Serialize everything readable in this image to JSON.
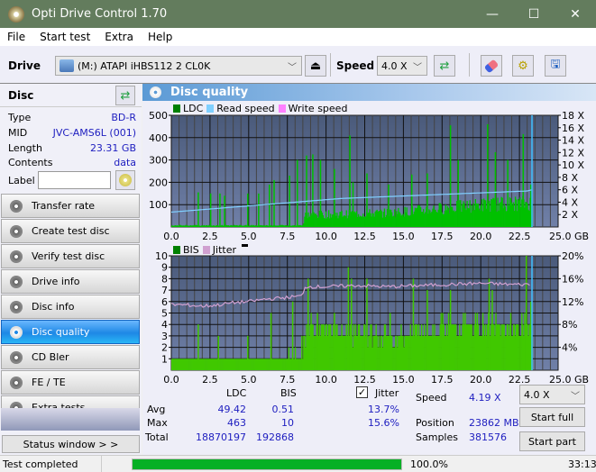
{
  "window": {
    "title": "Opti Drive Control 1.70",
    "minimize": "—",
    "maximize": "☐",
    "close": "✕"
  },
  "menu": [
    "File",
    "Start test",
    "Extra",
    "Help"
  ],
  "toolbar": {
    "drive_label": "Drive",
    "drive_value": "(M:)  ATAPI iHBS112  2 CL0K",
    "speed_label": "Speed",
    "speed_value": "4.0 X"
  },
  "disc": {
    "header": "Disc",
    "rows": [
      {
        "label": "Type",
        "value": "BD-R"
      },
      {
        "label": "MID",
        "value": "JVC-AMS6L (001)"
      },
      {
        "label": "Length",
        "value": "23.31 GB"
      },
      {
        "label": "Contents",
        "value": "data"
      }
    ],
    "label_field": "Label",
    "label_value": ""
  },
  "nav": [
    {
      "label": "Transfer rate",
      "active": false
    },
    {
      "label": "Create test disc",
      "active": false
    },
    {
      "label": "Verify test disc",
      "active": false
    },
    {
      "label": "Drive info",
      "active": false
    },
    {
      "label": "Disc info",
      "active": false
    },
    {
      "label": "Disc quality",
      "active": true
    },
    {
      "label": "CD Bler",
      "active": false
    },
    {
      "label": "FE / TE",
      "active": false
    },
    {
      "label": "Extra tests",
      "active": false
    }
  ],
  "status_window_btn": "Status window > >",
  "panel_title": "Disc quality",
  "colors": {
    "ldc": "#00c000",
    "read": "#80d0ff",
    "write": "#ff80ff",
    "bis": "#00c000",
    "jitter": "#d0a0d0",
    "plot_top": "#4a5a7a",
    "plot_bottom": "#7080a8",
    "progress": "#06b025"
  },
  "chart_data": [
    {
      "type": "bar",
      "title": "LDC",
      "legend": [
        "LDC",
        "Read speed",
        "Write speed"
      ],
      "xlabel": "GB",
      "x_ticks": [
        "0.0",
        "2.5",
        "5.0",
        "7.5",
        "10.0",
        "12.5",
        "15.0",
        "17.5",
        "20.0",
        "22.5",
        "25.0 GB"
      ],
      "xlim": [
        0,
        25
      ],
      "y_left_ticks": [
        "500",
        "400",
        "300",
        "200",
        "100"
      ],
      "ylim": [
        0,
        500
      ],
      "y_right_ticks": [
        "18 X",
        "16 X",
        "14 X",
        "12 X",
        "10 X",
        "8 X",
        "6 X",
        "4 X",
        "2 X"
      ],
      "y_right_lim": [
        0,
        18
      ],
      "ldc_baseline": [
        [
          0,
          8
        ],
        [
          8.5,
          8
        ],
        [
          8.6,
          60
        ],
        [
          14,
          70
        ],
        [
          17,
          90
        ],
        [
          20,
          110
        ],
        [
          23.3,
          120
        ]
      ],
      "ldc_peaks": [
        [
          1.7,
          155
        ],
        [
          2.5,
          150
        ],
        [
          3.1,
          150
        ],
        [
          3.4,
          140
        ],
        [
          4.9,
          150
        ],
        [
          5.6,
          150
        ],
        [
          6.3,
          190
        ],
        [
          6.6,
          210
        ],
        [
          7.6,
          230
        ],
        [
          8.1,
          300
        ],
        [
          8.7,
          320
        ],
        [
          9.1,
          325
        ],
        [
          9.6,
          300
        ],
        [
          10.5,
          260
        ],
        [
          11.5,
          410
        ],
        [
          11.7,
          200
        ],
        [
          12.6,
          240
        ],
        [
          14.0,
          190
        ],
        [
          15.5,
          235
        ],
        [
          16.5,
          240
        ],
        [
          18.0,
          455
        ],
        [
          18.5,
          300
        ],
        [
          20.4,
          460
        ],
        [
          20.9,
          335
        ],
        [
          21.7,
          300
        ],
        [
          22.7,
          416
        ],
        [
          23.2,
          190
        ]
      ],
      "read_speed": [
        [
          0,
          2.4
        ],
        [
          1,
          2.6
        ],
        [
          2,
          2.8
        ],
        [
          3,
          3.0
        ],
        [
          4,
          3.2
        ],
        [
          5,
          3.4
        ],
        [
          6,
          3.6
        ],
        [
          7,
          3.8
        ],
        [
          8,
          4.0
        ],
        [
          9,
          4.2
        ],
        [
          10,
          4.4
        ],
        [
          11,
          4.6
        ],
        [
          13,
          4.8
        ],
        [
          15,
          5.0
        ],
        [
          17,
          5.2
        ],
        [
          19,
          5.4
        ],
        [
          21,
          5.6
        ],
        [
          23,
          5.8
        ],
        [
          23.3,
          6.0
        ]
      ],
      "end_marker_gb": 23.31
    },
    {
      "type": "bar",
      "title": "BIS",
      "legend": [
        "BIS",
        "Jitter"
      ],
      "xlabel": "GB",
      "x_ticks": [
        "0.0",
        "2.5",
        "5.0",
        "7.5",
        "10.0",
        "12.5",
        "15.0",
        "17.5",
        "20.0",
        "22.5",
        "25.0 GB"
      ],
      "xlim": [
        0,
        25
      ],
      "y_left_ticks": [
        "10",
        "9",
        "8",
        "7",
        "6",
        "5",
        "4",
        "3",
        "2",
        "1"
      ],
      "ylim": [
        0,
        10
      ],
      "y_right_ticks": [
        "20%",
        "16%",
        "12%",
        "8%",
        "4%"
      ],
      "y_right_lim": [
        0,
        20
      ],
      "bis_baseline": [
        [
          0,
          1
        ],
        [
          7.5,
          1
        ],
        [
          7.6,
          2
        ],
        [
          8.6,
          3
        ],
        [
          9,
          4
        ],
        [
          14,
          3
        ],
        [
          17.5,
          4
        ],
        [
          23.3,
          4
        ]
      ],
      "bis_peaks": [
        [
          1.7,
          4
        ],
        [
          3.0,
          3
        ],
        [
          4.9,
          3
        ],
        [
          6.4,
          5
        ],
        [
          7.8,
          6
        ],
        [
          8.8,
          8
        ],
        [
          9.4,
          5
        ],
        [
          10.5,
          5
        ],
        [
          11.4,
          9
        ],
        [
          11.6,
          8
        ],
        [
          12.6,
          8
        ],
        [
          14.1,
          5
        ],
        [
          15.6,
          8
        ],
        [
          16.5,
          7
        ],
        [
          17.5,
          5
        ],
        [
          18.0,
          7
        ],
        [
          20.5,
          8
        ],
        [
          20.7,
          7
        ],
        [
          22.9,
          10
        ],
        [
          23.2,
          6
        ]
      ],
      "jitter": [
        [
          0,
          11.5
        ],
        [
          1,
          11.4
        ],
        [
          2,
          11.2
        ],
        [
          3,
          11.4
        ],
        [
          4,
          11.8
        ],
        [
          5,
          12.0
        ],
        [
          6,
          12.4
        ],
        [
          7,
          12.6
        ],
        [
          8.5,
          13.0
        ],
        [
          8.6,
          14.6
        ],
        [
          10,
          14.6
        ],
        [
          12,
          14.8
        ],
        [
          14,
          14.6
        ],
        [
          16,
          14.8
        ],
        [
          18,
          15.0
        ],
        [
          20,
          15.2
        ],
        [
          22,
          15.0
        ],
        [
          23.2,
          15.0
        ]
      ],
      "end_marker_gb": 23.31
    }
  ],
  "stats": {
    "col_ldc": "LDC",
    "col_bis": "BIS",
    "jitter_checked": true,
    "jitter_label": "Jitter",
    "avg_label": "Avg",
    "max_label": "Max",
    "total_label": "Total",
    "ldc_avg": "49.42",
    "ldc_max": "463",
    "ldc_total": "18870197",
    "bis_avg": "0.51",
    "bis_max": "10",
    "bis_total": "192868",
    "jitter_avg": "13.7%",
    "jitter_max": "15.6%",
    "speed_label": "Speed",
    "speed_value": "4.19 X",
    "position_label": "Position",
    "position_value": "23862 MB",
    "samples_label": "Samples",
    "samples_value": "381576",
    "speed_select": "4.0 X",
    "start_full": "Start full",
    "start_part": "Start part"
  },
  "statusbar": {
    "text": "Test completed",
    "progress_pct": 100,
    "progress_text": "100.0%",
    "time": "33:13"
  }
}
